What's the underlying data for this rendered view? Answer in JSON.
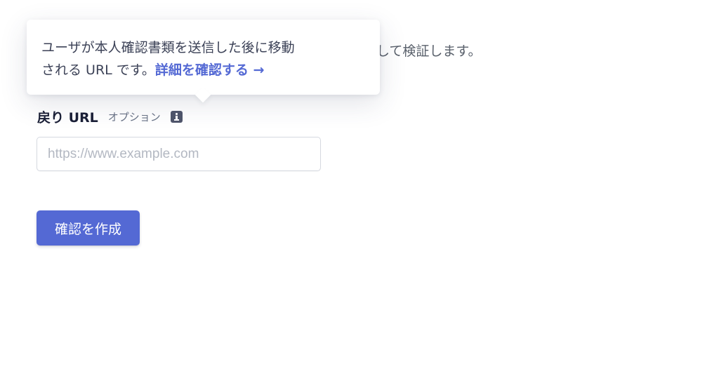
{
  "background": {
    "description_tail": "して検証します。"
  },
  "tooltip": {
    "line1": "ユーザが本人確認書類を送信した後に移動",
    "line2_text": "される URL です。",
    "link_label": "詳細を確認する",
    "link_arrow": "→"
  },
  "return_url_field": {
    "label": "戻り URL",
    "optional_label": "オプション",
    "value": "",
    "placeholder": "https://www.example.com"
  },
  "create_button": {
    "label": "確認を作成"
  },
  "colors": {
    "accent": "#5469d4",
    "text_primary": "#1a1f36",
    "text_secondary": "#697386"
  }
}
